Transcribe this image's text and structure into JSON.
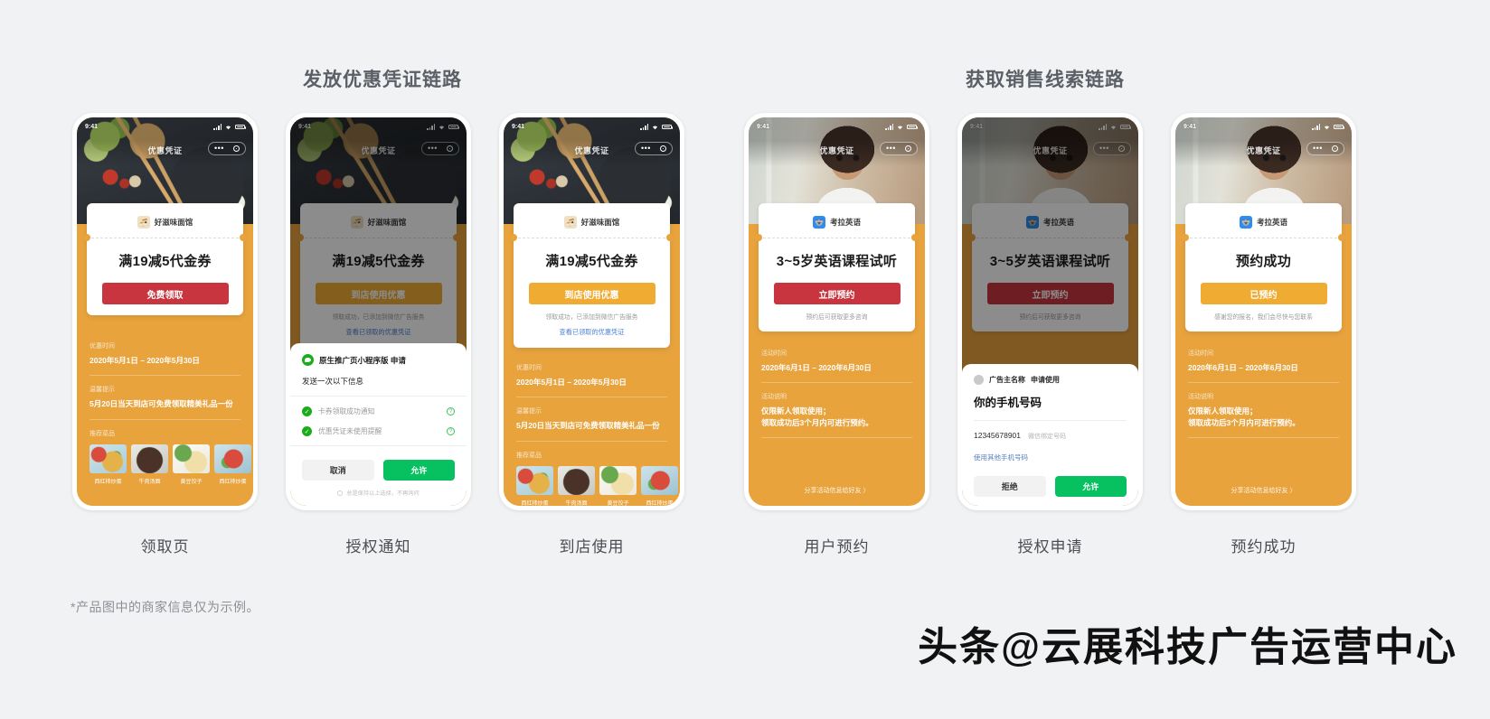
{
  "sections": {
    "left_title": "发放优惠凭证链路",
    "right_title": "获取销售线索链路"
  },
  "footnote": "*产品图中的商家信息仅为示例。",
  "watermark": "头条@云展科技广告运营中心",
  "colors": {
    "page_bg": "#f1f2f4",
    "orange": "#e8a33d",
    "btn_red": "#c9353f",
    "btn_orange": "#f0ab33",
    "wechat_green": "#07c160",
    "link_blue": "#4a7fd4",
    "title_gray": "#5b5f66"
  },
  "status_bar": {
    "time": "9:41"
  },
  "restaurant": {
    "page_label": "优惠凭证",
    "brand": "好滋味面馆",
    "coupon_title": "满19减5代金券",
    "claim_button": "免费领取",
    "use_button": "到店使用优惠",
    "claimed_note": "领取成功，已添加到微信广告服务",
    "claimed_link": "查看已领取的优惠凭证",
    "time_label": "优惠时间",
    "time_value": "2020年5月1日 – 2020年5月30日",
    "tip_label": "温馨提示",
    "tip_value": "5月20日当天到店可免费领取精美礼品一份",
    "dish_label": "推荐菜品",
    "dishes": [
      {
        "name": "西红柿炒蛋"
      },
      {
        "name": "牛肉汤面"
      },
      {
        "name": "黄豆饺子"
      },
      {
        "name": "西红柿炒蛋"
      }
    ]
  },
  "wechat_auth": {
    "app_name": "原生推广页小程序版 申请",
    "description": "发送一次以下信息",
    "permissions": [
      "卡券领取成功通知",
      "优惠凭证未使用提醒"
    ],
    "cancel_button": "取消",
    "allow_button": "允许",
    "footer": "总是保持以上选择，不再询问",
    "question_icon": "question-mark"
  },
  "english": {
    "page_label": "优惠凭证",
    "brand": "考拉英语",
    "course_title": "3~5岁英语课程试听",
    "book_button": "立即预约",
    "book_note": "预约后可获取更多咨询",
    "booked_title": "预约成功",
    "booked_button": "已预约",
    "booked_note": "感谢您的报名，我们会尽快与您联系",
    "time_label": "活动时间",
    "time_value": "2020年6月1日 – 2020年6月30日",
    "desc_label": "活动说明",
    "desc_value_line1": "仅限新人领取使用；",
    "desc_value_line2": "领取成功后3个月内可进行预约。",
    "share_link": "分享活动信息给好友 〉"
  },
  "phone_auth": {
    "advertiser": "广告主名称",
    "apply_text": "申请使用",
    "title": "你的手机号码",
    "number": "12345678901",
    "number_tag": "微信绑定号码",
    "other_number": "使用其他手机号码",
    "refuse_button": "拒绝",
    "allow_button": "允许"
  },
  "captions": {
    "p1": "领取页",
    "p2": "授权通知",
    "p3": "到店使用",
    "p4": "用户预约",
    "p5": "授权申请",
    "p6": "预约成功"
  }
}
